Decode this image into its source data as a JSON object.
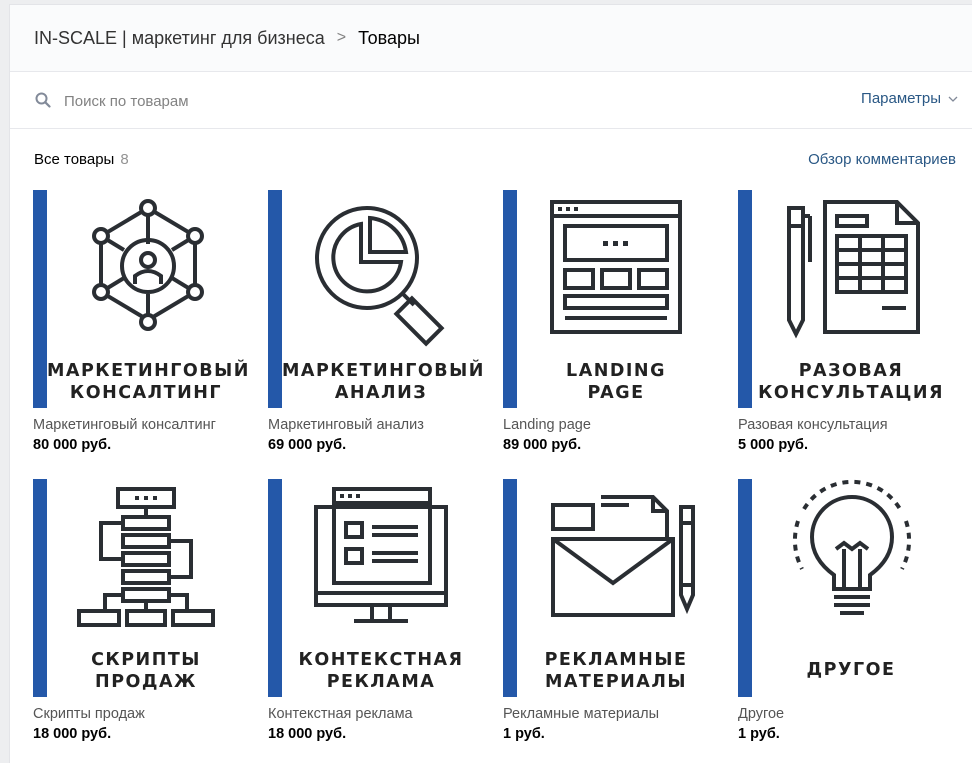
{
  "header": {
    "owner": "IN-SCALE | маркетинг для бизнеса",
    "separator": ">",
    "current": "Товары"
  },
  "search": {
    "placeholder": "Поиск по товарам",
    "params_label": "Параметры"
  },
  "list": {
    "all_label": "Все товары",
    "count": "8",
    "reviews_link": "Обзор комментариев"
  },
  "icons": {
    "network": "network-user-icon",
    "analysis": "magnifier-pie-chart-icon",
    "landing": "webpage-layout-icon",
    "consult": "document-pen-icon",
    "scripts": "flowchart-icon",
    "context": "monitor-ad-icon",
    "materials": "envelope-pencil-icon",
    "other": "lightbulb-icon"
  },
  "colors": {
    "accent_bar": "#2458a9",
    "link": "#2a5885",
    "icon_stroke": "#2a2e33"
  },
  "products": [
    {
      "line1": "МАРКЕТИНГОВЫЙ",
      "line2": "КОНСАЛТИНГ",
      "caption": "Маркетинговый консалтинг",
      "price": "80 000 руб."
    },
    {
      "line1": "МАРКЕТИНГОВЫЙ",
      "line2": "АНАЛИЗ",
      "caption": "Маркетинговый анализ",
      "price": "69 000 руб."
    },
    {
      "line1": "LANDING",
      "line2": "PAGE",
      "caption": "Landing page",
      "price": "89 000 руб."
    },
    {
      "line1": "РАЗОВАЯ",
      "line2": "КОНСУЛЬТАЦИЯ",
      "caption": "Разовая консультация",
      "price": "5 000 руб."
    },
    {
      "line1": "СКРИПТЫ",
      "line2": "ПРОДАЖ",
      "caption": "Скрипты продаж",
      "price": "18 000 руб."
    },
    {
      "line1": "КОНТЕКСТНАЯ",
      "line2": "РЕКЛАМА",
      "caption": "Контекстная реклама",
      "price": "18 000 руб."
    },
    {
      "line1": "РЕКЛАМНЫЕ",
      "line2": "МАТЕРИАЛЫ",
      "caption": "Рекламные материалы",
      "price": "1 руб."
    },
    {
      "line1": "ДРУГОЕ",
      "caption": "Другое",
      "price": "1 руб."
    }
  ]
}
